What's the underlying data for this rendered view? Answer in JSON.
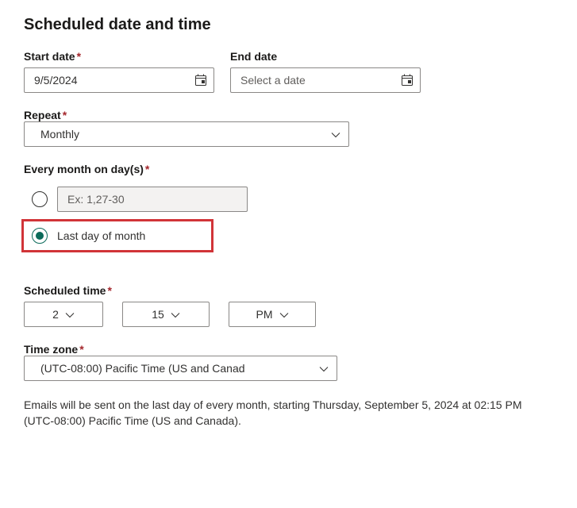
{
  "heading": "Scheduled date and time",
  "start_date": {
    "label": "Start date",
    "value": "9/5/2024"
  },
  "end_date": {
    "label": "End date",
    "placeholder": "Select a date"
  },
  "repeat": {
    "label": "Repeat",
    "value": "Monthly"
  },
  "day_options": {
    "label": "Every month on day(s)",
    "specific_placeholder": "Ex: 1,27-30",
    "last_day_label": "Last day of month"
  },
  "scheduled_time": {
    "label": "Scheduled time",
    "hour": "2",
    "minute": "15",
    "ampm": "PM"
  },
  "timezone": {
    "label": "Time zone",
    "value": "(UTC-08:00) Pacific Time (US and Canad"
  },
  "summary": "Emails will be sent on the last day of every month, starting Thursday, September 5, 2024 at 02:15 PM (UTC-08:00) Pacific Time (US and Canada)."
}
